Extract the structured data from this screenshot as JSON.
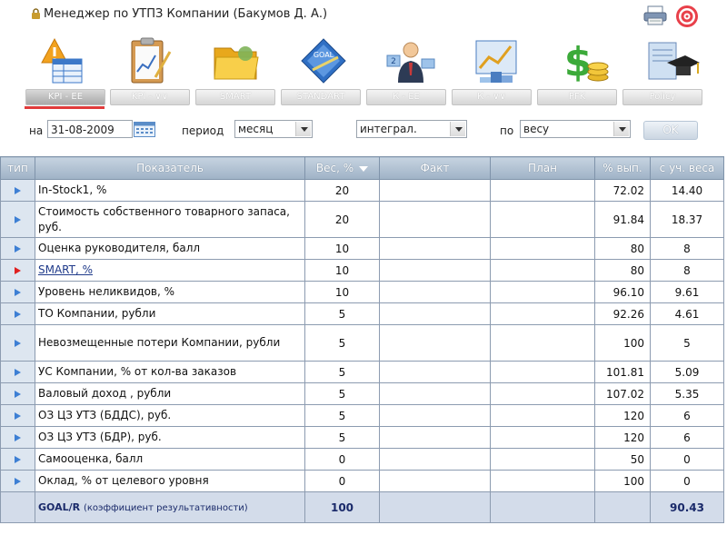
{
  "window": {
    "title": "Менеджер по УТПЗ Компании  (Бакумов Д. А.)"
  },
  "tools": [
    {
      "icon": "warning-table-icon"
    },
    {
      "icon": "clipboard-chart-icon"
    },
    {
      "icon": "folder-icon"
    },
    {
      "icon": "goal-diamond-icon"
    },
    {
      "icon": "ranking-person-icon"
    },
    {
      "icon": "chart-podium-icon"
    },
    {
      "icon": "dollar-coins-icon"
    },
    {
      "icon": "diploma-cap-icon"
    }
  ],
  "tabs": [
    "KPI - ЕЕ",
    "KPI - ∨∨",
    "SMART",
    "STANDART",
    "К - ЕЕ",
    "К - ∨∨",
    "PFK",
    "Policy"
  ],
  "filters": {
    "date_label": "на",
    "date_value": "31-08-2009",
    "period_label": "период",
    "period_value": "месяц",
    "mode_value": "интеграл.",
    "by_label": "по",
    "by_value": "весу",
    "ok_label": "OK"
  },
  "table": {
    "headers": {
      "type": "тип",
      "indicator": "Показатель",
      "weight": "Вес, %",
      "fact": "Факт",
      "plan": "План",
      "pct": "% вып.",
      "weighted": "с уч. веса"
    },
    "rows": [
      {
        "flag": "blue",
        "name": "In-Stock1, %",
        "weight": "20",
        "pct": "72.02",
        "weighted": "14.40"
      },
      {
        "flag": "blue",
        "name": "Стоимость собственного товарного запаса, руб.",
        "weight": "20",
        "pct": "91.84",
        "weighted": "18.37"
      },
      {
        "flag": "blue",
        "name": "Оценка руководителя, балл",
        "weight": "10",
        "pct": "80",
        "weighted": "8"
      },
      {
        "flag": "red",
        "name": "SMART, %",
        "weight": "10",
        "pct": "80",
        "weighted": "8"
      },
      {
        "flag": "blue",
        "name": "Уровень неликвидов, %",
        "weight": "10",
        "pct": "96.10",
        "weighted": "9.61"
      },
      {
        "flag": "blue",
        "name": "ТО Компании, рубли",
        "weight": "5",
        "pct": "92.26",
        "weighted": "4.61"
      },
      {
        "flag": "blue",
        "name": "Невозмещенные потери Компании, рубли",
        "weight": "5",
        "pct": "100",
        "weighted": "5"
      },
      {
        "flag": "blue",
        "name": "УС Компании, % от кол-ва заказов",
        "weight": "5",
        "pct": "101.81",
        "weighted": "5.09"
      },
      {
        "flag": "blue",
        "name": "Валовый доход , рубли",
        "weight": "5",
        "pct": "107.02",
        "weighted": "5.35"
      },
      {
        "flag": "blue",
        "name": "ОЗ ЦЗ УТЗ (БДДС), руб.",
        "weight": "5",
        "pct": "120",
        "weighted": "6"
      },
      {
        "flag": "blue",
        "name": "ОЗ ЦЗ УТЗ (БДР), руб.",
        "weight": "5",
        "pct": "120",
        "weighted": "6"
      },
      {
        "flag": "blue",
        "name": "Самооценка, балл",
        "weight": "0",
        "pct": "50",
        "weighted": "0"
      },
      {
        "flag": "blue",
        "name": "Оклад, % от целевого уровня",
        "weight": "0",
        "pct": "100",
        "weighted": "0"
      }
    ],
    "total": {
      "name": "GOAL/R",
      "name_sub": "(коэффициент результативности)",
      "weight": "100",
      "weighted": "90.43"
    }
  },
  "colors": {
    "accent_red": "#e03b3b",
    "header_blue": "#9fb2c6",
    "flag_blue": "#3d7fd4",
    "flag_red": "#e02020"
  }
}
